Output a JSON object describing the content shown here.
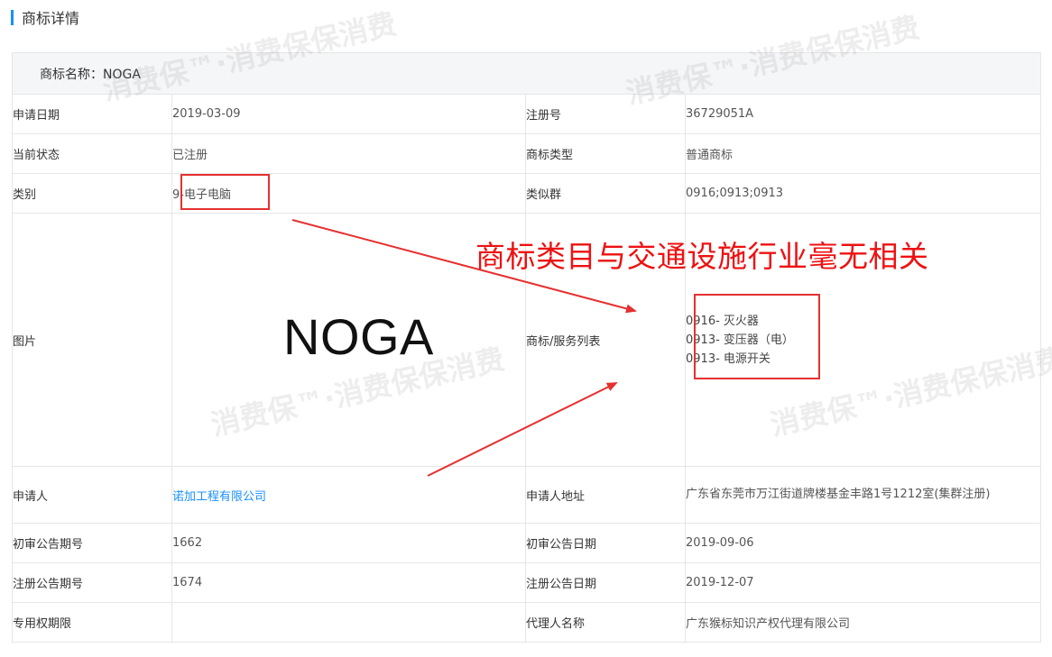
{
  "section": {
    "title": "商标详情"
  },
  "trademark": {
    "name_label": "商标名称：NOGA",
    "rows": [
      {
        "l1": "申请日期",
        "v1": "2019-03-09",
        "l2": "注册号",
        "v2": "36729051A"
      },
      {
        "l1": "当前状态",
        "v1": "已注册",
        "l2": "商标类型",
        "v2": "普通商标"
      },
      {
        "l1": "类别",
        "v1": "9-电子电脑",
        "l2": "类似群",
        "v2": "0916;0913;0913"
      }
    ],
    "image_label": "图片",
    "logo_text": "NOGA",
    "service_label": "商标/服务列表",
    "services": [
      "0916- 灭火器",
      "0913- 变压器（电）",
      "0913- 电源开关"
    ],
    "applicant_label": "申请人",
    "applicant": "诺加工程有限公司",
    "address_label": "申请人地址",
    "address": "广东省东莞市万江街道牌楼基金丰路1号1212室(集群注册)",
    "rows2": [
      {
        "l1": "初审公告期号",
        "v1": "1662",
        "l2": "初审公告日期",
        "v2": "2019-09-06"
      },
      {
        "l1": "注册公告期号",
        "v1": "1674",
        "l2": "注册公告日期",
        "v2": "2019-12-07"
      },
      {
        "l1": "专用权期限",
        "v1": "",
        "l2": "代理人名称",
        "v2": "广东猴标知识产权代理有限公司"
      }
    ]
  },
  "annotation": {
    "text": "商标类目与交通设施行业毫无相关",
    "color": "#ee1111"
  },
  "watermark": {
    "text": "消费保™·消费保保消费"
  },
  "colors": {
    "accent": "#1890ff",
    "link": "#1890ff",
    "annotation_red": "#e53030"
  }
}
